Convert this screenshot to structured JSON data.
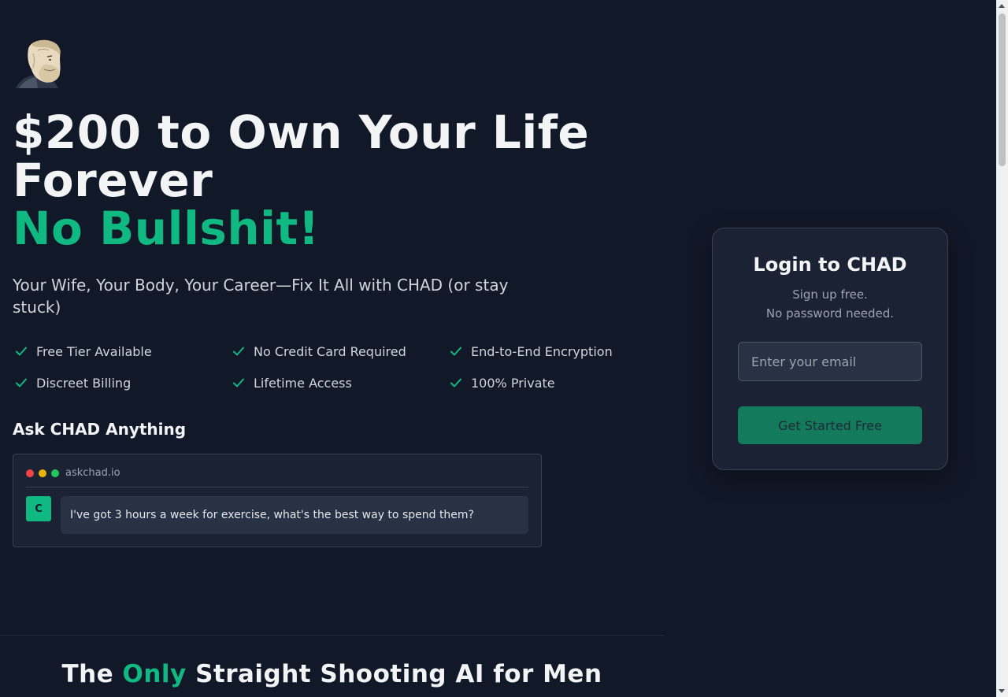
{
  "logo": {
    "icon": "bearded-man-portrait-icon"
  },
  "hero": {
    "title_line1": "$200 to Own Your Life",
    "title_line2": "Forever",
    "title_accent": "No Bullshit!",
    "subtitle": "Your Wife, Your Body, Your Career—Fix It All with CHAD (or stay stuck)"
  },
  "features": [
    {
      "label": "Free Tier Available"
    },
    {
      "label": "No Credit Card Required"
    },
    {
      "label": "End-to-End Encryption"
    },
    {
      "label": "Discreet Billing"
    },
    {
      "label": "Lifetime Access"
    },
    {
      "label": "100% Private"
    }
  ],
  "ask": {
    "title": "Ask CHAD Anything",
    "url": "askchad.io",
    "avatar_letter": "C",
    "message": "I've got 3 hours a week for exercise, what's the best way to spend them?"
  },
  "bottom": {
    "title_before": "The",
    "title_accent": "Only",
    "title_after": "Straight Shooting AI for Men"
  },
  "login": {
    "title": "Login to CHAD",
    "sub_line1": "Sign up free.",
    "sub_line2": "No password needed.",
    "email_placeholder": "Enter your email",
    "cta_label": "Get Started Free"
  },
  "colors": {
    "background": "#111827",
    "accent": "#10b981",
    "card": "#1a2233",
    "button": "#137a5c",
    "dot_red": "#ef4444",
    "dot_yellow": "#eab308",
    "dot_green": "#22c55e"
  }
}
